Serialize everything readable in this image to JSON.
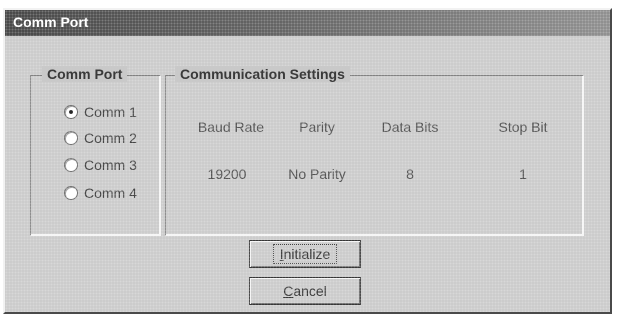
{
  "window": {
    "title": "Comm Port"
  },
  "comm_port_group": {
    "legend": "Comm Port",
    "options": [
      {
        "label": "Comm 1",
        "selected": true
      },
      {
        "label": "Comm 2",
        "selected": false
      },
      {
        "label": "Comm 3",
        "selected": false
      },
      {
        "label": "Comm 4",
        "selected": false
      }
    ]
  },
  "settings_group": {
    "legend": "Communication Settings",
    "headers": {
      "baud_rate": "Baud Rate",
      "parity": "Parity",
      "data_bits": "Data Bits",
      "stop_bit": "Stop Bit"
    },
    "values": {
      "baud_rate": "19200",
      "parity": "No Parity",
      "data_bits": "8",
      "stop_bit": "1"
    }
  },
  "buttons": {
    "initialize": {
      "prefix": "",
      "accel": "I",
      "rest": "nitialize"
    },
    "cancel": {
      "prefix": "",
      "accel": "C",
      "rest": "ancel"
    }
  }
}
